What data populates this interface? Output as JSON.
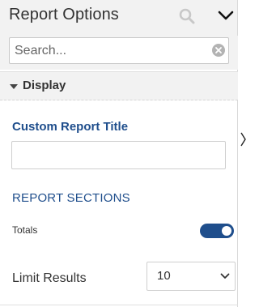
{
  "panel": {
    "title": "Report Options",
    "header_icons": [
      "search-icon",
      "chevron-down-icon"
    ]
  },
  "search": {
    "placeholder": "Search...",
    "value": "",
    "clear_icon": "clear-icon"
  },
  "display_section": {
    "label": "Display",
    "expanded": true,
    "custom_title": {
      "label": "Custom Report Title",
      "value": ""
    },
    "report_sections": {
      "heading": "REPORT SECTIONS",
      "totals": {
        "label": "Totals",
        "enabled": true
      }
    },
    "limit_results": {
      "label": "Limit Results",
      "selected": "10"
    }
  },
  "colors": {
    "accent": "#1f4e8c",
    "header_bg": "#f2f2f2",
    "text": "#333333"
  }
}
